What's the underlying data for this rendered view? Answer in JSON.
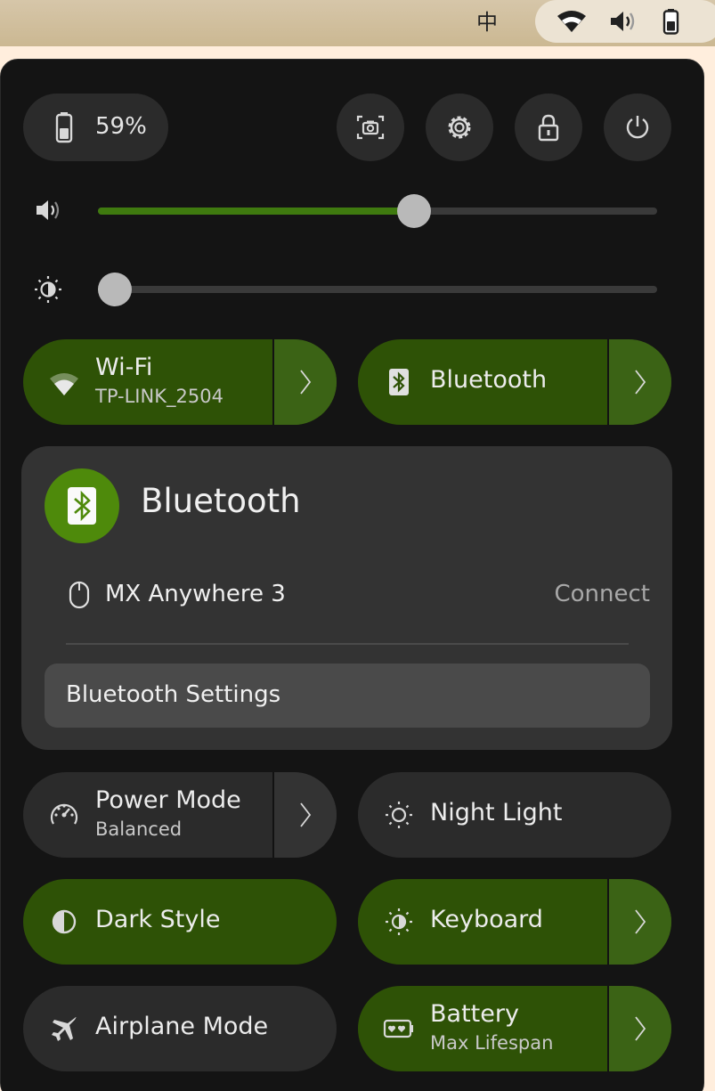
{
  "topbar": {
    "ime_label": "中",
    "icons": [
      "wifi-icon",
      "volume-icon",
      "battery-icon"
    ]
  },
  "header": {
    "battery_percent": "59%",
    "buttons": [
      "screenshot-icon",
      "settings-icon",
      "lock-icon",
      "power-icon"
    ]
  },
  "sliders": {
    "volume_level": 0.57,
    "brightness_level": 0.0
  },
  "tiles": {
    "wifi": {
      "title": "Wi-Fi",
      "subtitle": "TP-LINK_2504",
      "active": true
    },
    "bluetooth": {
      "title": "Bluetooth",
      "active": true
    },
    "power_mode": {
      "title": "Power Mode",
      "subtitle": "Balanced",
      "active": false
    },
    "night_light": {
      "title": "Night Light",
      "active": false
    },
    "dark_style": {
      "title": "Dark Style",
      "active": true
    },
    "keyboard": {
      "title": "Keyboard",
      "active": true
    },
    "airplane": {
      "title": "Airplane Mode",
      "active": false
    },
    "battery": {
      "title": "Battery",
      "subtitle": "Max Lifespan",
      "active": true
    }
  },
  "bluetooth_menu": {
    "title": "Bluetooth",
    "devices": [
      {
        "name": "MX Anywhere 3",
        "action": "Connect",
        "icon": "mouse-icon"
      }
    ],
    "settings_label": "Bluetooth Settings"
  },
  "colors": {
    "accent_active": "#2e5206",
    "accent_badge": "#4e8a0b",
    "panel_bg": "#141414"
  }
}
